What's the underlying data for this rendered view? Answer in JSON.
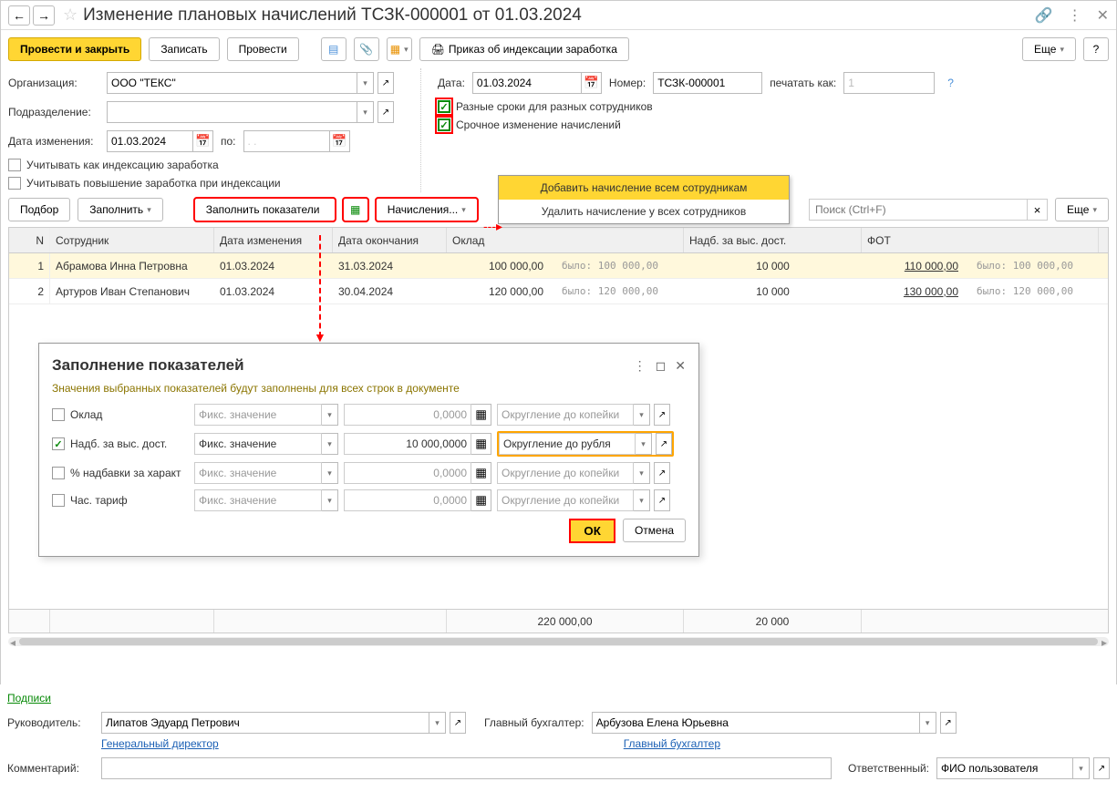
{
  "titlebar": {
    "title": "Изменение плановых начислений ТСЗК-000001 от 01.03.2024"
  },
  "toolbar": {
    "post_close": "Провести и закрыть",
    "save": "Записать",
    "post": "Провести",
    "order_index": "Приказ об индексации заработка",
    "more": "Еще"
  },
  "form": {
    "org_label": "Организация:",
    "org_value": "ООО \"ТЕКС\"",
    "dept_label": "Подразделение:",
    "dept_value": "",
    "change_date_label": "Дата изменения:",
    "change_date": "01.03.2024",
    "to_label": "по:",
    "to_value": ". .",
    "date_label": "Дата:",
    "date_value": "01.03.2024",
    "num_label": "Номер:",
    "num_value": "ТСЗК-000001",
    "print_as_label": "печатать как:",
    "print_as_value": "1",
    "cb_diff_dates": "Разные сроки для разных сотрудников",
    "cb_urgent": "Срочное изменение начислений",
    "cb_index": "Учитывать как индексацию заработка",
    "cb_increase": "Учитывать повышение заработка при индексации"
  },
  "toolbar2": {
    "select": "Подбор",
    "fill": "Заполнить",
    "fill_indicators": "Заполнить показатели",
    "accruals": "Начисления...",
    "search_ph": "Поиск (Ctrl+F)",
    "more": "Еще"
  },
  "menu": {
    "add_all": "Добавить начисление всем сотрудникам",
    "del_all": "Удалить начисление у всех сотрудников"
  },
  "table": {
    "headers": {
      "n": "N",
      "emp": "Сотрудник",
      "d1": "Дата изменения",
      "d2": "Дата окончания",
      "oklad": "Оклад",
      "nadb": "Надб. за выс. дост.",
      "fot": "ФОТ"
    },
    "rows": [
      {
        "n": "1",
        "emp": "Абрамова Инна Петровна",
        "d1": "01.03.2024",
        "d2": "31.03.2024",
        "oklad": "100 000,00",
        "oklad_was": "было: 100 000,00",
        "nadb": "10 000",
        "fot": "110 000,00",
        "fot_was": "было: 100 000,00"
      },
      {
        "n": "2",
        "emp": "Артуров Иван Степанович",
        "d1": "01.03.2024",
        "d2": "30.04.2024",
        "oklad": "120 000,00",
        "oklad_was": "было: 120 000,00",
        "nadb": "10 000",
        "fot": "130 000,00",
        "fot_was": "было: 120 000,00"
      }
    ],
    "footer": {
      "oklad_sum": "220 000,00",
      "nadb_sum": "20 000"
    }
  },
  "dialog": {
    "title": "Заполнение показателей",
    "subtitle": "Значения выбранных показателей будут заполнены для всех строк в документе",
    "rows": [
      {
        "checked": false,
        "label": "Оклад",
        "mode": "Фикс. значение",
        "value": "0,0000",
        "round": "Округление до копейки"
      },
      {
        "checked": true,
        "label": "Надб. за выс. дост.",
        "mode": "Фикс. значение",
        "value": "10 000,0000",
        "round": "Округление до рубля"
      },
      {
        "checked": false,
        "label": "% надбавки за характ",
        "mode": "Фикс. значение",
        "value": "0,0000",
        "round": "Округление до копейки"
      },
      {
        "checked": false,
        "label": "Час. тариф",
        "mode": "Фикс. значение",
        "value": "0,0000",
        "round": "Округление до копейки"
      }
    ],
    "ok": "ОК",
    "cancel": "Отмена"
  },
  "footer": {
    "sign_link": "Подписи",
    "head_label": "Руководитель:",
    "head_value": "Липатов Эдуард Петрович",
    "head_pos": "Генеральный директор",
    "acc_label": "Главный бухгалтер:",
    "acc_value": "Арбузова Елена Юрьевна",
    "acc_pos": "Главный бухгалтер",
    "comment_label": "Комментарий:",
    "resp_label": "Ответственный:",
    "resp_value": "ФИО пользователя"
  }
}
